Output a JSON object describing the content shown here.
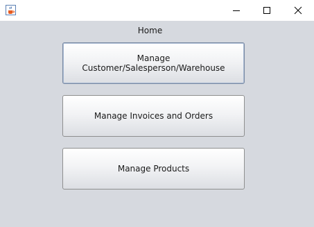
{
  "window": {
    "app_icon": "java-coffee-cup-icon",
    "controls": {
      "minimize_icon": "minimize-icon",
      "maximize_icon": "maximize-icon",
      "close_icon": "close-icon"
    }
  },
  "main": {
    "heading": "Home",
    "buttons": [
      {
        "label": "Manage Customer/Salesperson/Warehouse"
      },
      {
        "label": "Manage Invoices and Orders"
      },
      {
        "label": "Manage Products"
      }
    ]
  },
  "colors": {
    "background": "#d6d9df",
    "titlebar": "#ffffff",
    "focus_border": "#7a8aa3"
  }
}
